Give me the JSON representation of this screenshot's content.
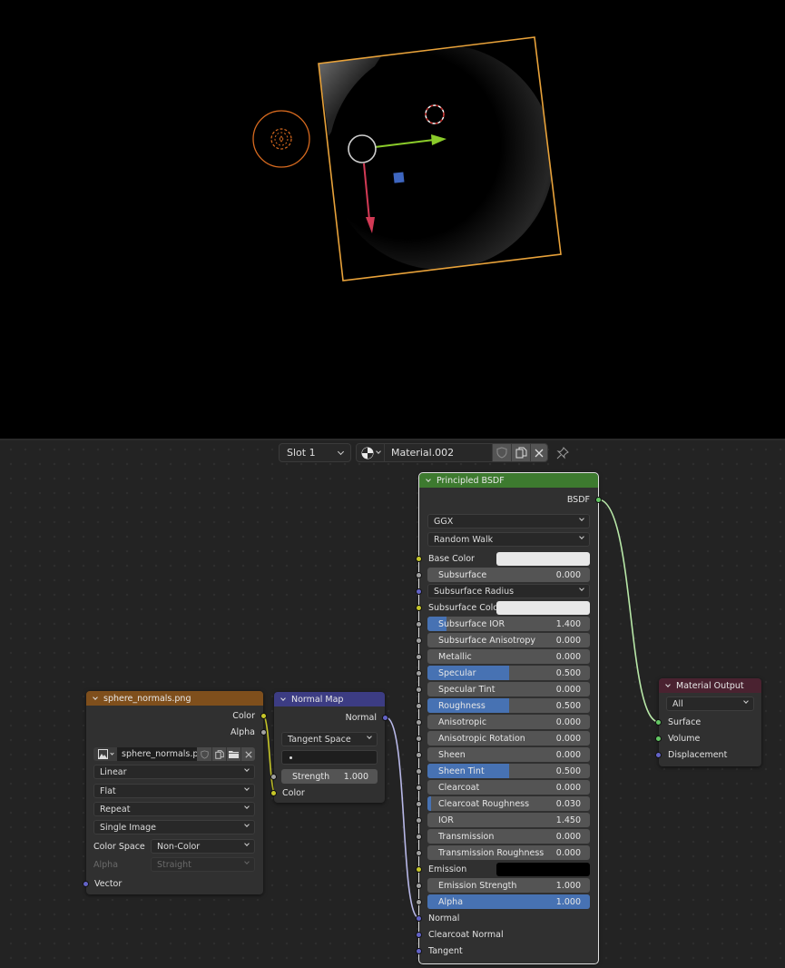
{
  "viewport": {
    "colors": {
      "background": "#000000",
      "plane_outline": "#e8a23a",
      "light_circle": "#d76a1f",
      "x_axis_arrow": "#d23a55",
      "y_axis_arrow": "#8acb2a",
      "origin_ring": "#cfcfcf",
      "center_square": "#3e66c0"
    }
  },
  "header": {
    "slot_label": "Slot 1",
    "material_name": "Material.002",
    "icons": [
      "material-sphere-icon",
      "fake-user-shield-icon",
      "duplicate-icon",
      "unlink-x-icon",
      "pin-icon"
    ]
  },
  "nodes": {
    "image_texture": {
      "title": "sphere_normals.png",
      "header_color": "#7f4f1c",
      "outputs": [
        "Color",
        "Alpha"
      ],
      "image_name": "sphere_normals.png",
      "interpolation": "Linear",
      "projection": "Flat",
      "extension": "Repeat",
      "source": "Single Image",
      "color_space_label": "Color Space",
      "color_space": "Non-Color",
      "alpha_label": "Alpha",
      "alpha_mode": "Straight",
      "inputs": [
        "Vector"
      ]
    },
    "normal_map": {
      "title": "Normal Map",
      "header_color": "#3c3c83",
      "output": "Normal",
      "space": "Tangent Space",
      "uv_map": "",
      "strength_label": "Strength",
      "strength_value": "1.000",
      "color_input": "Color"
    },
    "principled_bsdf": {
      "title": "Principled BSDF",
      "header_color": "#3d7a2f",
      "output": "BSDF",
      "distribution": "GGX",
      "subsurface_method": "Random Walk",
      "base_color_label": "Base Color",
      "subsurface_radius_label": "Subsurface Radius",
      "subsurface_color_label": "Subsurface Color",
      "emission_label": "Emission",
      "params": [
        {
          "label": "Subsurface",
          "value": "0.000",
          "fill": 0.0
        },
        {
          "label": "Subsurface IOR",
          "value": "1.400",
          "fill": 0.12
        },
        {
          "label": "Subsurface Anisotropy",
          "value": "0.000",
          "fill": 0.0
        },
        {
          "label": "Metallic",
          "value": "0.000",
          "fill": 0.0
        },
        {
          "label": "Specular",
          "value": "0.500",
          "fill": 0.5
        },
        {
          "label": "Specular Tint",
          "value": "0.000",
          "fill": 0.0
        },
        {
          "label": "Roughness",
          "value": "0.500",
          "fill": 0.5
        },
        {
          "label": "Anisotropic",
          "value": "0.000",
          "fill": 0.0
        },
        {
          "label": "Anisotropic Rotation",
          "value": "0.000",
          "fill": 0.0
        },
        {
          "label": "Sheen",
          "value": "0.000",
          "fill": 0.0
        },
        {
          "label": "Sheen Tint",
          "value": "0.500",
          "fill": 0.5
        },
        {
          "label": "Clearcoat",
          "value": "0.000",
          "fill": 0.0
        },
        {
          "label": "Clearcoat Roughness",
          "value": "0.030",
          "fill": 0.03
        },
        {
          "label": "IOR",
          "value": "1.450",
          "fill": 0.0
        },
        {
          "label": "Transmission",
          "value": "0.000",
          "fill": 0.0
        },
        {
          "label": "Transmission Roughness",
          "value": "0.000",
          "fill": 0.0
        },
        {
          "label": "Emission Strength",
          "value": "1.000",
          "fill": 0.0
        },
        {
          "label": "Alpha",
          "value": "1.000",
          "fill": 1.0
        }
      ],
      "vector_inputs": [
        "Normal",
        "Clearcoat Normal",
        "Tangent"
      ],
      "base_color": "#e8e8e8",
      "subsurface_color": "#e8e8e8",
      "emission_color": "#000000"
    },
    "material_output": {
      "title": "Material Output",
      "header_color": "#4a2230",
      "target": "All",
      "inputs": [
        "Surface",
        "Volume",
        "Displacement"
      ]
    }
  }
}
